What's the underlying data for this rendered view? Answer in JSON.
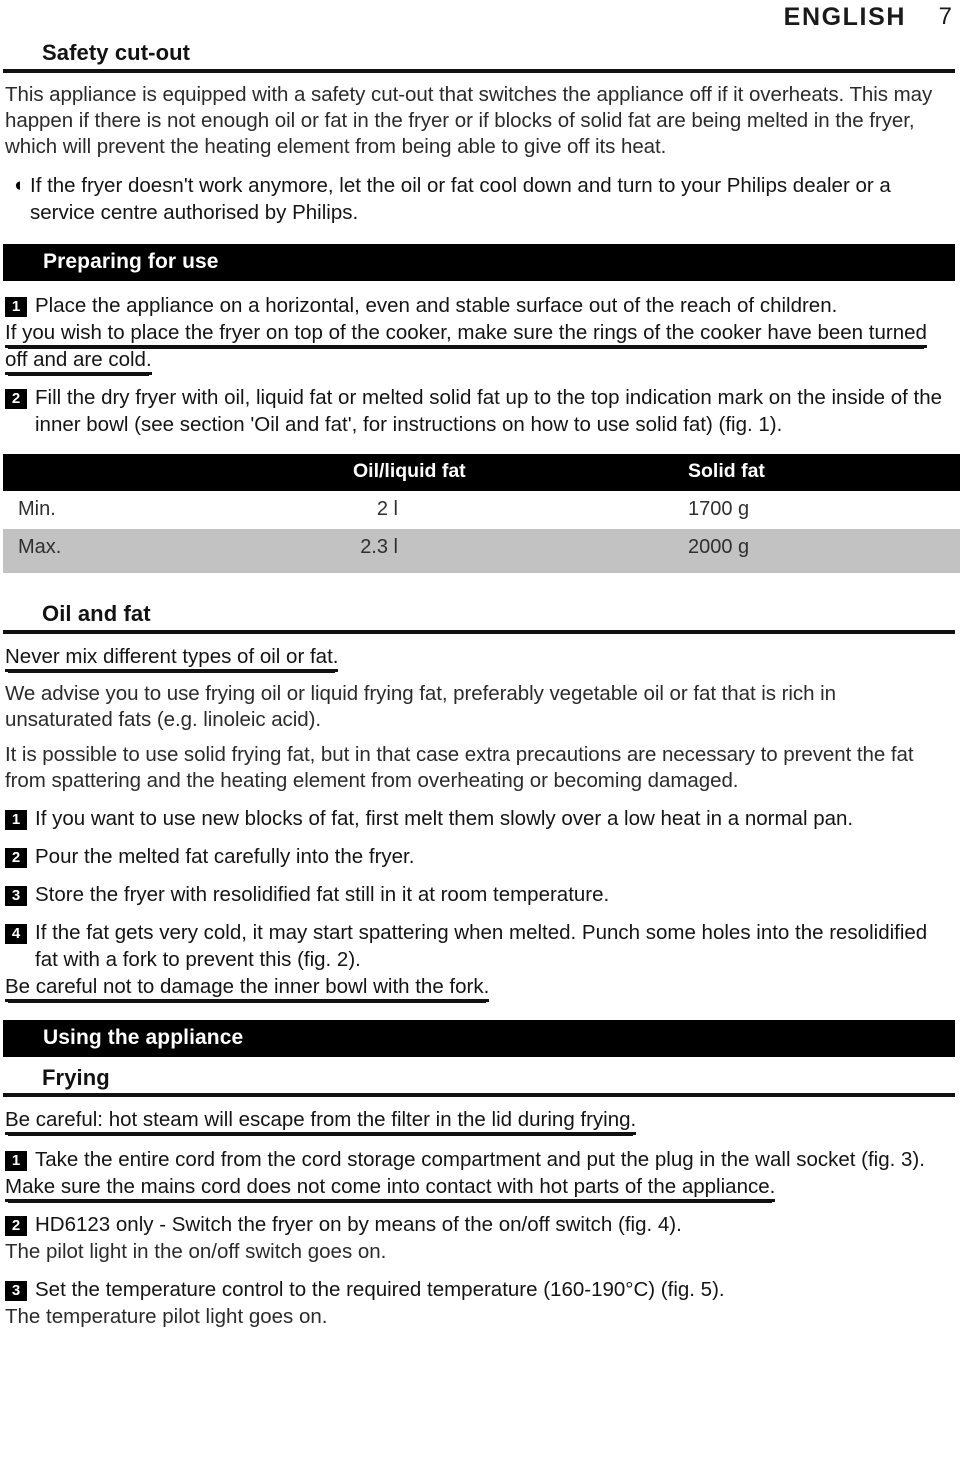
{
  "header": {
    "language": "ENGLISH",
    "page_number": "7"
  },
  "sections": {
    "safety_cutout": {
      "heading": "Safety cut-out",
      "paragraph": "This appliance is equipped with a safety cut-out that switches the appliance off if it overheats. This may happen if there is not enough oil or fat in the fryer or if blocks of solid fat are being melted in the fryer, which will prevent the heating element from being able to give off its heat.",
      "bullet_glyph": "arrow-bullet",
      "bullet_text": "If the fryer doesn't work anymore, let the oil or fat cool down and turn to your Philips dealer or a service centre authorised by Philips."
    },
    "preparing_for_use": {
      "banner": "Preparing for use",
      "step1": {
        "number": "1",
        "text": "Place the appliance on a horizontal, even and stable surface out of the reach of children.",
        "note": "If you wish to place the fryer on top of the cooker, make sure the rings of the cooker have been turned off and are cold."
      },
      "step2": {
        "number": "2",
        "text": "Fill the dry fryer with oil, liquid fat or melted solid fat up to the top indication mark on the inside of the inner bowl (see section 'Oil and fat', for instructions on how to use solid fat) (fig. 1)."
      },
      "table": {
        "columns": [
          "",
          "Oil/liquid fat",
          "Solid fat"
        ],
        "rows": [
          {
            "label": "Min.",
            "oil": "2 l",
            "solid": "1700 g"
          },
          {
            "label": "Max.",
            "oil": "2.3 l",
            "solid": "2000 g"
          }
        ]
      }
    },
    "oil_and_fat": {
      "heading": "Oil and fat",
      "warning": "Never mix different types of oil or fat.",
      "paragraph1": "We advise you to use frying oil or liquid frying fat, preferably vegetable oil or fat that is rich in unsaturated fats (e.g. linoleic acid).",
      "paragraph2": "It is possible to use solid frying fat, but in that case extra precautions are necessary to prevent the fat from spattering and the heating element from overheating or becoming damaged.",
      "steps": [
        {
          "number": "1",
          "text": "If you want to use new blocks of fat, first melt them slowly over a low heat in a normal pan."
        },
        {
          "number": "2",
          "text": "Pour the melted fat carefully into the fryer."
        },
        {
          "number": "3",
          "text": "Store the fryer with resolidified fat still in it at room temperature."
        },
        {
          "number": "4",
          "text": "If the fat gets very cold, it may start spattering when melted. Punch some holes into the resolidified fat with a fork to prevent this (fig. 2)."
        }
      ],
      "closing_warning": "Be careful not to damage the inner bowl with the fork."
    },
    "using_the_appliance": {
      "banner": "Using the appliance",
      "frying": {
        "heading": "Frying",
        "warning": "Be careful: hot steam will escape from the filter in the lid during frying.",
        "steps": [
          {
            "number": "1",
            "text": "Take the entire cord from the cord storage compartment and put the plug in the wall socket (fig. 3).",
            "note": "Make sure the mains cord does not come into contact with hot parts of the appliance."
          },
          {
            "number": "2",
            "text": "HD6123 only - Switch the fryer on by means of the on/off switch (fig. 4).",
            "note": "The pilot light in the on/off switch goes on."
          },
          {
            "number": "3",
            "text": "Set the temperature control to the required temperature (160-190°C) (fig. 5).",
            "note": "The temperature pilot light goes on."
          }
        ]
      }
    }
  }
}
